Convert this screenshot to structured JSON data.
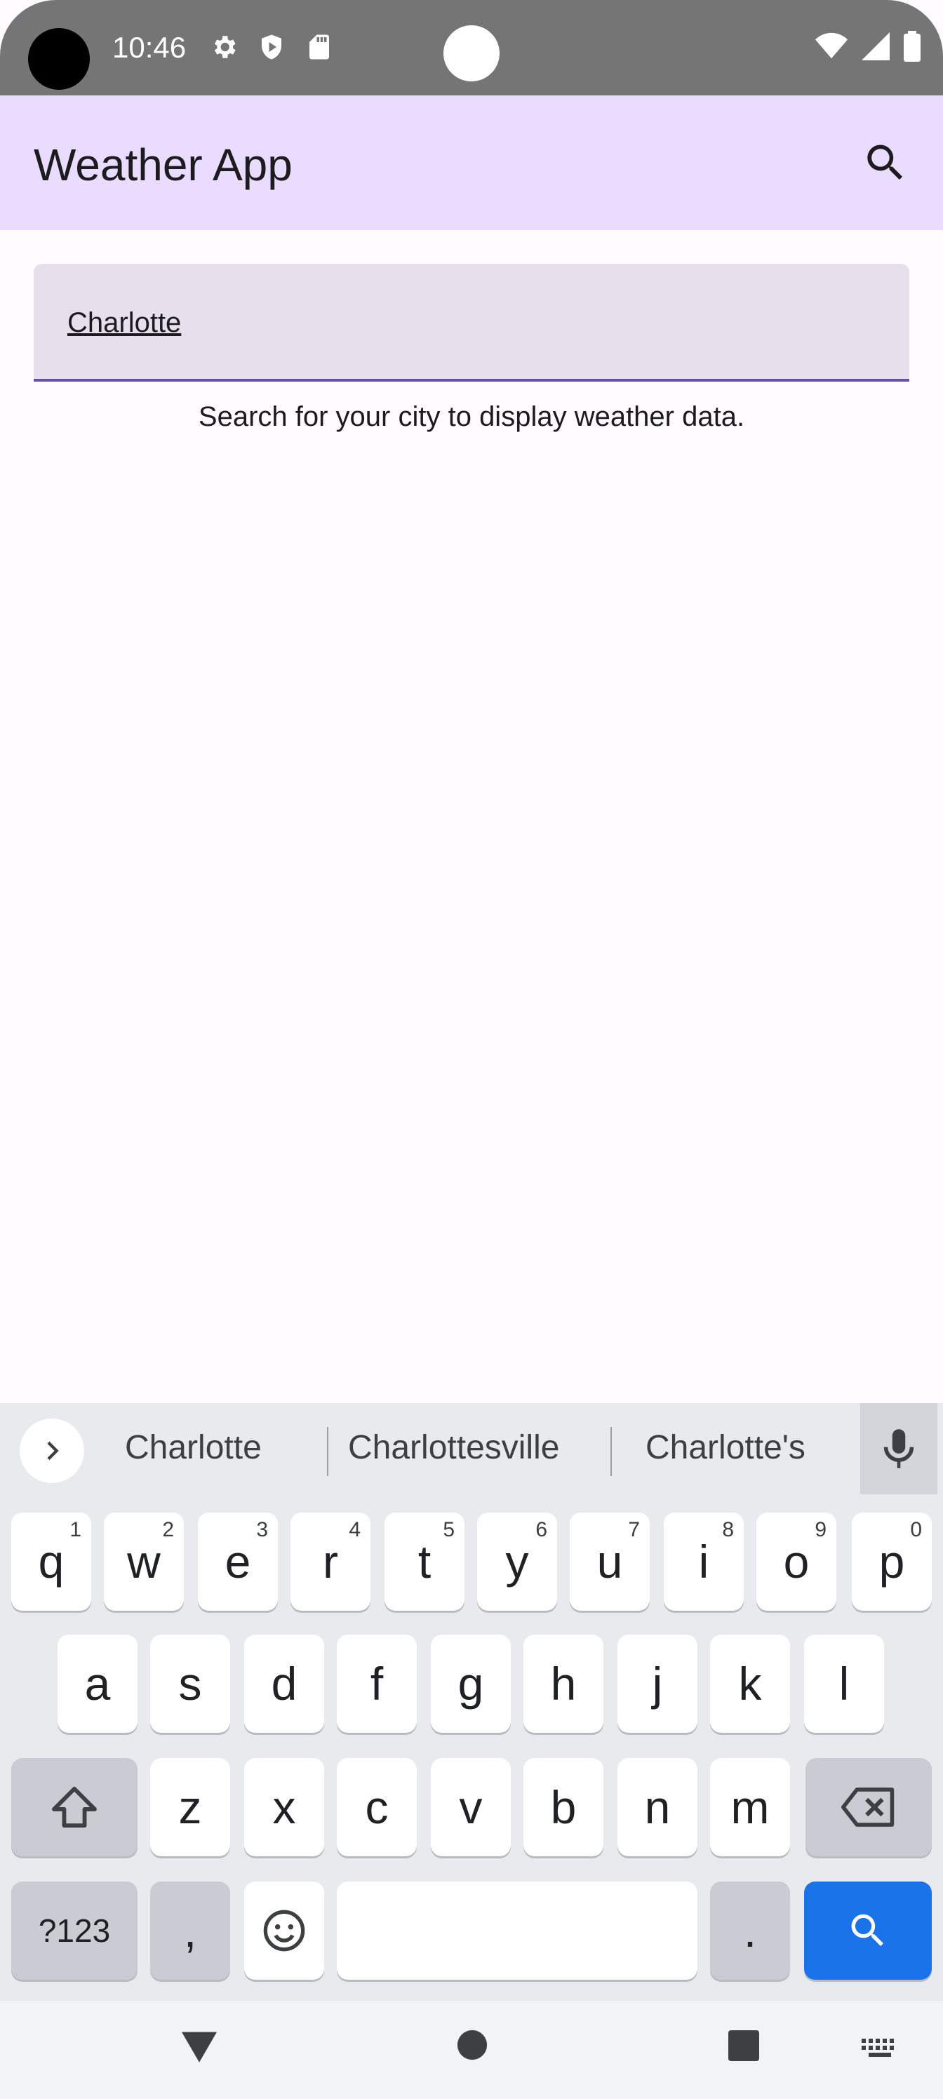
{
  "status_bar": {
    "time": "10:46",
    "icons_left": [
      "gear-icon",
      "shield-icon",
      "sd-card-icon"
    ],
    "icons_right": [
      "wifi-icon",
      "signal-icon",
      "battery-icon"
    ]
  },
  "app_bar": {
    "title": "Weather App",
    "search_icon": "search-icon"
  },
  "search_field": {
    "value": "Charlotte"
  },
  "hint_text": "Search for your city to display weather data.",
  "keyboard": {
    "suggestions": [
      "Charlotte",
      "Charlottesville",
      "Charlotte's"
    ],
    "row1": [
      {
        "key": "q",
        "num": "1"
      },
      {
        "key": "w",
        "num": "2"
      },
      {
        "key": "e",
        "num": "3"
      },
      {
        "key": "r",
        "num": "4"
      },
      {
        "key": "t",
        "num": "5"
      },
      {
        "key": "y",
        "num": "6"
      },
      {
        "key": "u",
        "num": "7"
      },
      {
        "key": "i",
        "num": "8"
      },
      {
        "key": "o",
        "num": "9"
      },
      {
        "key": "p",
        "num": "0"
      }
    ],
    "row2": [
      "a",
      "s",
      "d",
      "f",
      "g",
      "h",
      "j",
      "k",
      "l"
    ],
    "row3": [
      "z",
      "x",
      "c",
      "v",
      "b",
      "n",
      "m"
    ],
    "symbols_label": "?123",
    "comma_label": ",",
    "period_label": ".",
    "action_color": "#1a73e8"
  },
  "colors": {
    "app_bar": "#eadcff",
    "accent": "#6750a4",
    "field_bg": "#e7e0ec",
    "background": "#fffbff"
  }
}
